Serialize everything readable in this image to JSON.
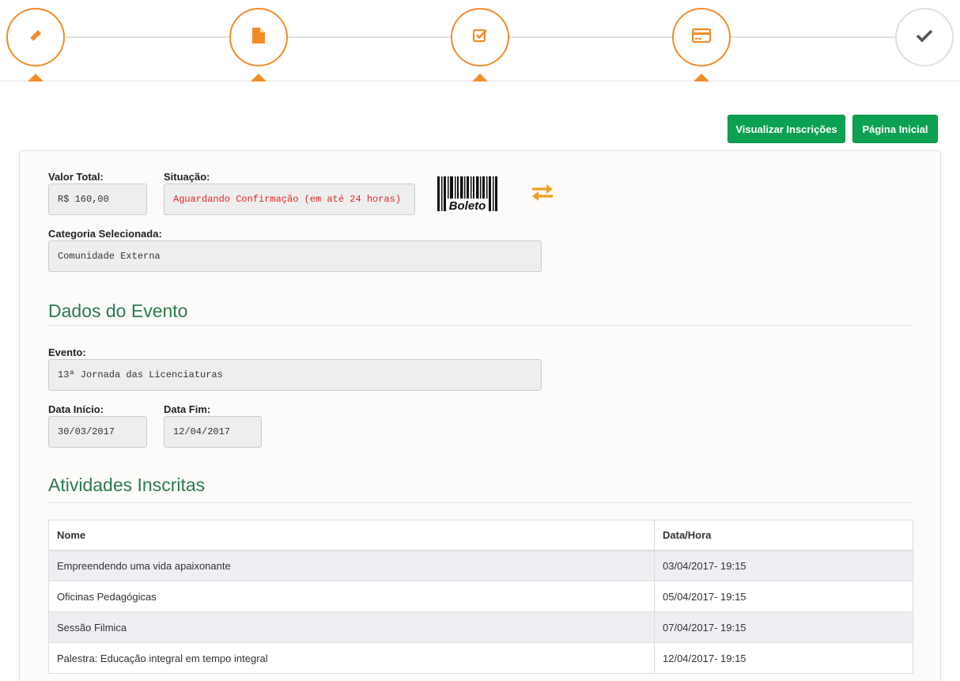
{
  "wizard": {
    "steps": [
      {
        "icon": "pencil-icon",
        "state": "completed"
      },
      {
        "icon": "document-icon",
        "state": "completed"
      },
      {
        "icon": "checkbox-icon",
        "state": "completed"
      },
      {
        "icon": "credit-card-icon",
        "state": "completed"
      },
      {
        "icon": "checkmark-icon",
        "state": "current"
      }
    ],
    "accent_color": "#f28c28"
  },
  "header": {
    "view_registrations_label": "Visualizar Inscrições",
    "home_label": "Página Inicial",
    "button_color": "#0ca152"
  },
  "payment": {
    "total_label": "Valor Total:",
    "total_value": "R$ 160,00",
    "status_label": "Situação:",
    "status_value": "Aguardando Confirmação (em até 24 horas)",
    "status_color": "#e0262a",
    "boleto_text": "Boleto",
    "category_label": "Categoria Selecionada:",
    "category_value": "Comunidade Externa"
  },
  "event": {
    "section_title": "Dados do Evento",
    "event_label": "Evento:",
    "event_value": "13ª Jornada das Licenciaturas",
    "start_label": "Data Início:",
    "start_value": "30/03/2017",
    "end_label": "Data Fim:",
    "end_value": "12/04/2017"
  },
  "activities": {
    "section_title": "Atividades Inscritas",
    "columns": [
      "Nome",
      "Data/Hora"
    ],
    "rows": [
      {
        "name": "Empreendendo uma vida apaixonante",
        "datetime": "03/04/2017- 19:15"
      },
      {
        "name": "Oficinas Pedagógicas",
        "datetime": "05/04/2017- 19:15"
      },
      {
        "name": "Sessão Filmica",
        "datetime": "07/04/2017- 19:15"
      },
      {
        "name": "Palestra: Educação integral em tempo integral",
        "datetime": "12/04/2017- 19:15"
      }
    ]
  },
  "section_title_color": "#2d7a4f"
}
